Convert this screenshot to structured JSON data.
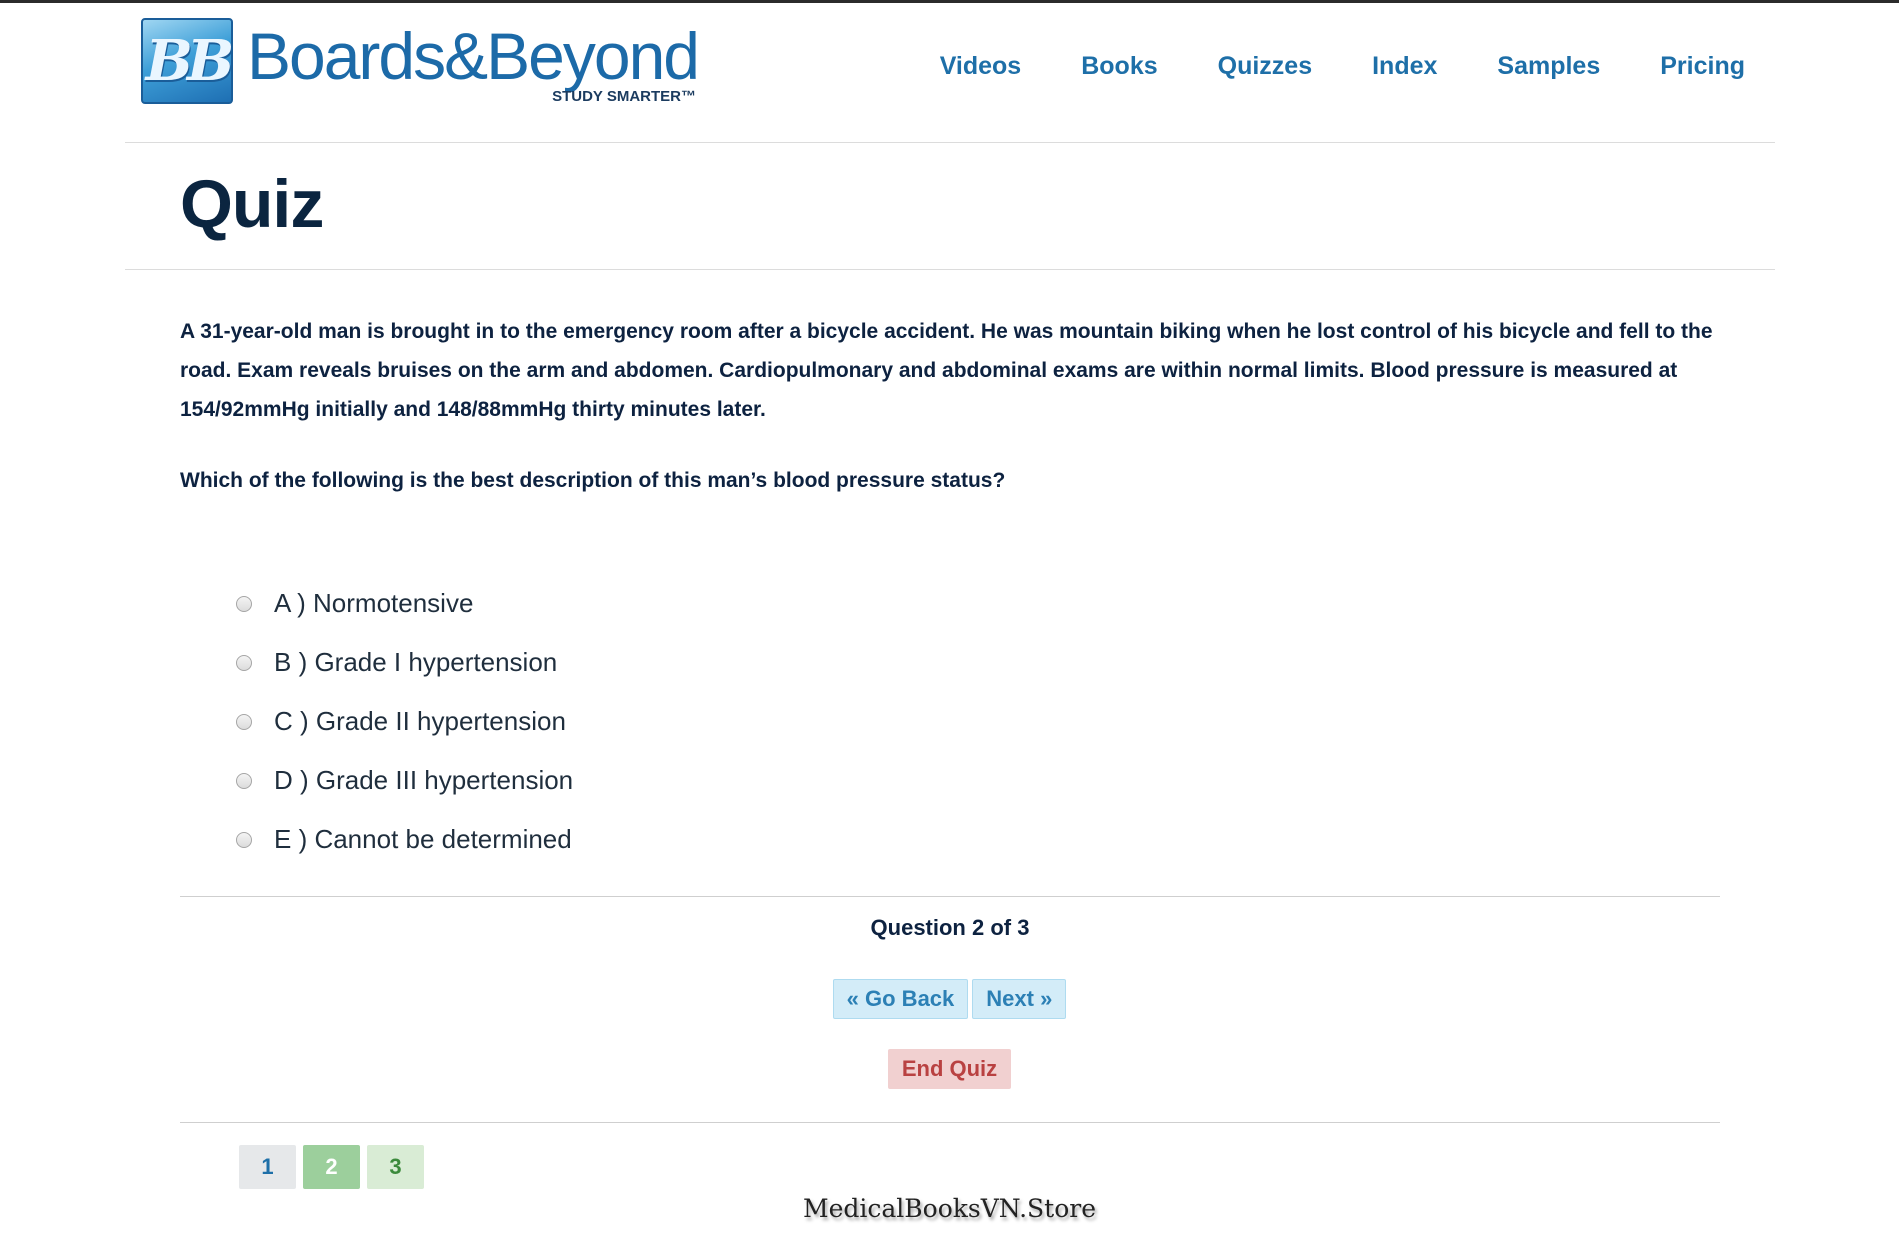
{
  "header": {
    "logo_badge": "BB",
    "logo_name": "Boards&Beyond",
    "logo_tagline": "STUDY SMARTER™",
    "nav": [
      "Videos",
      "Books",
      "Quizzes",
      "Index",
      "Samples",
      "Pricing"
    ]
  },
  "page": {
    "title": "Quiz"
  },
  "question": {
    "stem": "A 31-year-old man is brought in to the emergency room after a bicycle accident. He was mountain biking when he lost control of his bicycle and fell to the road. Exam reveals bruises on the arm and abdomen. Cardiopulmonary and abdominal exams are within normal limits. Blood pressure is measured at 154/92mmHg initially and 148/88mmHg thirty minutes later.",
    "prompt": "Which of the following is the best description of this man’s blood pressure status?",
    "options": [
      "A ) Normotensive",
      "B ) Grade I hypertension",
      "C ) Grade II hypertension",
      "D ) Grade III hypertension",
      "E ) Cannot be determined"
    ]
  },
  "progress": {
    "counter": "Question 2 of 3",
    "back_label": "« Go Back",
    "next_label": "Next »",
    "end_label": "End Quiz",
    "pages": [
      "1",
      "2",
      "3"
    ],
    "current_page": 2
  },
  "watermark": "MedicalBooksVN.Store",
  "colors": {
    "brand_blue": "#1e6fa8",
    "title_navy": "#0b2540",
    "nav_button_bg": "#d3ecf8",
    "end_button_bg": "#f1d0d0",
    "current_page_bg": "#9ccf9c"
  }
}
